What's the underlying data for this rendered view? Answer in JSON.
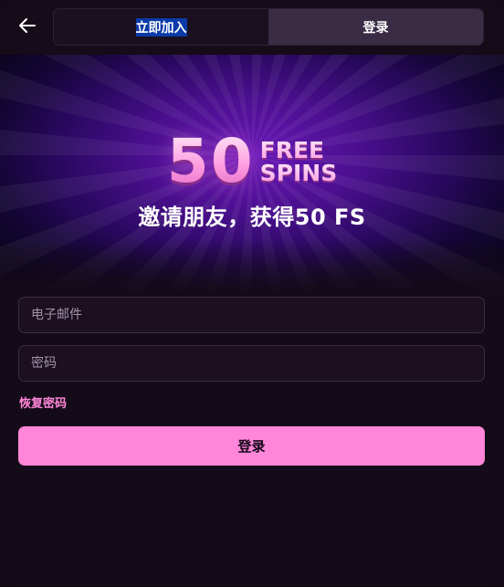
{
  "header": {
    "back_icon": "arrow-left-icon",
    "tabs": [
      {
        "label": "立即加入",
        "selected": true
      },
      {
        "label": "登录",
        "selected": false
      }
    ]
  },
  "banner": {
    "number": "50",
    "word_line1": "FREE",
    "word_line2": "SPINS",
    "subtitle": "邀请朋友，获得50 FS"
  },
  "form": {
    "email_placeholder": "电子邮件",
    "email_value": "",
    "password_placeholder": "密码",
    "password_value": "",
    "forgot_label": "恢复密码",
    "submit_label": "登录"
  },
  "colors": {
    "accent": "#ff86d9",
    "background": "#140b18",
    "selection": "#0b3aa8"
  }
}
